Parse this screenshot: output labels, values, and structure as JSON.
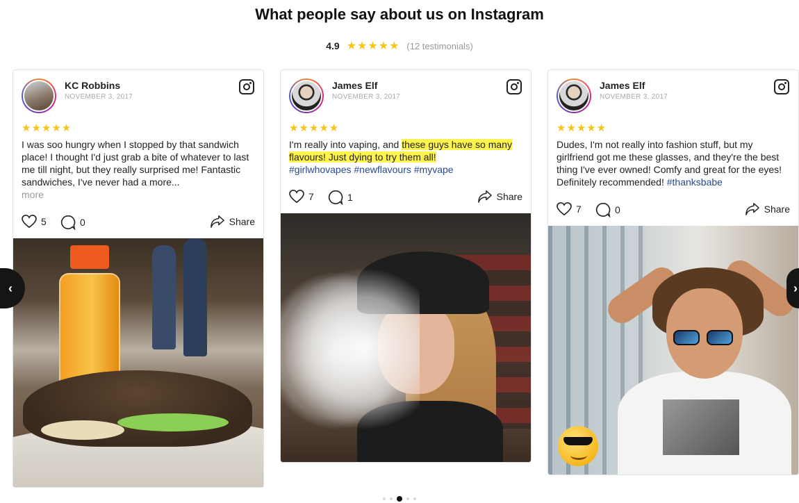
{
  "header": {
    "title": "What people say about us on Instagram",
    "rating": "4.9",
    "stars": "★★★★★",
    "count": "(12 testimonials)"
  },
  "cards": [
    {
      "name": "KC Robbins",
      "date": "NOVEMBER 3, 2017",
      "stars": "★★★★★",
      "text": "I was soo hungry when I stopped by that sandwich place! I thought I'd just grab a bite of whatever to last me till night, but they really surprised me! Fantastic sandwiches, I've never had a more...",
      "more": "more",
      "likes": "5",
      "comments": "0",
      "share": "Share"
    },
    {
      "name": "James Elf",
      "date": "NOVEMBER 3, 2017",
      "stars": "★★★★★",
      "text_before": "I'm really into vaping, and ",
      "text_highlight": "these guys have so many flavours! Just dying to try them all!",
      "hashtags": "#girlwhovapes #newflavours #myvape",
      "likes": "7",
      "comments": "1",
      "share": "Share"
    },
    {
      "name": "James Elf",
      "date": "NOVEMBER 3, 2017",
      "stars": "★★★★★",
      "text": "Dudes, I'm not really into fashion stuff, but my girlfriend got me these glasses, and they're the best thing I've ever owned! Comfy and great for the eyes! Definitely recommended! ",
      "hashtag": "#thanksbabe",
      "likes": "7",
      "comments": "0",
      "share": "Share"
    }
  ],
  "navigation": {
    "prev": "‹",
    "next": "›",
    "dots_total": 5,
    "dots_active": 3
  }
}
